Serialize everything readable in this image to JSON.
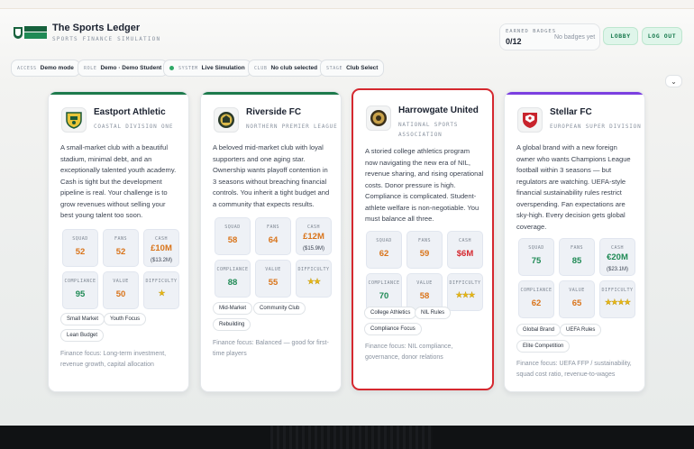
{
  "app": {
    "title": "The Sports Ledger",
    "subtitle": "SPORTS FINANCE SIMULATION",
    "logo_text": "THE SPORTS LEDGER"
  },
  "badges": {
    "label": "EARNED BADGES",
    "value": "0/12",
    "empty_text": "No badges yet"
  },
  "buttons": {
    "lobby": "LOBBY",
    "logout": "LOG OUT"
  },
  "context": [
    {
      "key": "ACCESS",
      "value": "Demo mode"
    },
    {
      "key": "ROLE",
      "value": "Demo · Demo Student"
    },
    {
      "key": "SYSTEM",
      "value": "Live Simulation",
      "status_color": "#2fa866"
    },
    {
      "key": "CLUB",
      "value": "No club selected"
    },
    {
      "key": "STAGE",
      "value": "Club Select"
    }
  ],
  "clubs": [
    {
      "name": "Eastport Athletic",
      "league": "COASTAL DIVISION ONE",
      "accent": "#1d7a4c",
      "description": [
        "A small-market club with a beautiful",
        "stadium, minimal debt, and an",
        "exceptionally talented youth academy.",
        "Cash is tight but the development",
        "pipeline is real. Your challenge is to",
        "grow revenues without selling your",
        "best young talent too soon."
      ],
      "stats": {
        "squad": {
          "label": "SQUAD",
          "value": "52"
        },
        "fans": {
          "label": "FANS",
          "value": "52"
        },
        "cash": {
          "label": "CASH",
          "value": "£10M",
          "sub": "($13.2M)"
        },
        "compliance": {
          "label": "COMPLIANCE",
          "value": "95"
        },
        "value": {
          "label": "VALUE",
          "value": "50"
        },
        "difficulty": {
          "label": "DIFFICULTY",
          "stars": "★"
        }
      },
      "tags": [
        "Small Market",
        "Youth Focus",
        "Lean Budget"
      ],
      "focus": [
        "Finance focus: Long-term investment,",
        "revenue growth, capital allocation"
      ]
    },
    {
      "name": "Riverside FC",
      "league": "NORTHERN PREMIER LEAGUE",
      "accent": "#1d7a4c",
      "description": [
        "A beloved mid-market club with loyal",
        "supporters and one aging star.",
        "Ownership wants playoff contention in",
        "3 seasons without breaching financial",
        "controls. You inherit a tight budget and",
        "a community that expects results."
      ],
      "stats": {
        "squad": {
          "label": "SQUAD",
          "value": "58"
        },
        "fans": {
          "label": "FANS",
          "value": "64"
        },
        "cash": {
          "label": "CASH",
          "value": "£12M",
          "sub": "($15.9M)"
        },
        "compliance": {
          "label": "COMPLIANCE",
          "value": "88"
        },
        "value": {
          "label": "VALUE",
          "value": "55"
        },
        "difficulty": {
          "label": "DIFFICULTY",
          "stars": "★★"
        }
      },
      "tags": [
        "Mid-Market",
        "Community Club",
        "Rebuilding"
      ],
      "focus": [
        "Finance focus: Balanced — good for first-",
        "time players"
      ]
    },
    {
      "name": "Harrowgate United",
      "league": "NATIONAL SPORTS ASSOCIATION",
      "accent": "#d5282f",
      "description": [
        "A storied college athletics program",
        "now navigating the new era of NIL,",
        "revenue sharing, and rising operational",
        "costs. Donor pressure is high.",
        "Compliance is complicated. Student-",
        "athlete welfare is non-negotiable. You",
        "must balance all three."
      ],
      "stats": {
        "squad": {
          "label": "SQUAD",
          "value": "62"
        },
        "fans": {
          "label": "FANS",
          "value": "59"
        },
        "cash": {
          "label": "CASH",
          "value": "$6M"
        },
        "compliance": {
          "label": "COMPLIANCE",
          "value": "70"
        },
        "value": {
          "label": "VALUE",
          "value": "58"
        },
        "difficulty": {
          "label": "DIFFICULTY",
          "stars": "★★★"
        }
      },
      "tags": [
        "College Athletics",
        "NIL Rules",
        "Compliance Focus"
      ],
      "focus": [
        "Finance focus: NIL compliance,",
        "governance, donor relations"
      ]
    },
    {
      "name": "Stellar FC",
      "league": "EUROPEAN SUPER DIVISION",
      "accent": "#7b3fe0",
      "description": [
        "A global brand with a new foreign",
        "owner who wants Champions League",
        "football within 3 seasons — but",
        "regulators are watching. UEFA-style",
        "financial sustainability rules restrict",
        "overspending. Fan expectations are",
        "sky-high. Every decision gets global",
        "coverage."
      ],
      "stats": {
        "squad": {
          "label": "SQUAD",
          "value": "75"
        },
        "fans": {
          "label": "FANS",
          "value": "85"
        },
        "cash": {
          "label": "CASH",
          "value": "€20M",
          "sub": "($23.1M)"
        },
        "compliance": {
          "label": "COMPLIANCE",
          "value": "62"
        },
        "value": {
          "label": "VALUE",
          "value": "65"
        },
        "difficulty": {
          "label": "DIFFICULTY",
          "stars": "★★★★"
        }
      },
      "tags": [
        "Global Brand",
        "UEFA Rules",
        "Elite Competition"
      ],
      "focus": [
        "Finance focus: UEFA FFP / sustainability,",
        "squad cost ratio, revenue-to-wages"
      ]
    }
  ],
  "colors": {
    "good": "#1f8a55",
    "warn": "#d9741a",
    "bad": "#d5282f",
    "selected": "#d5282f"
  }
}
